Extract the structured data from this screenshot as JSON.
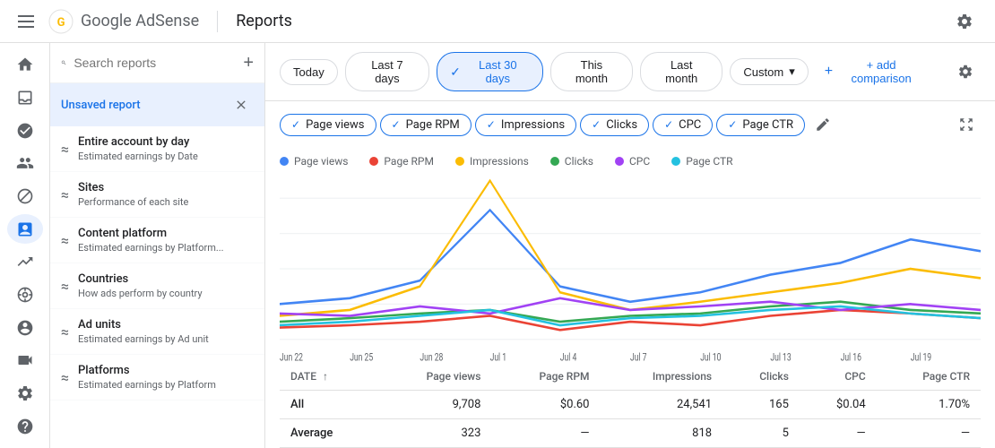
{
  "app": {
    "name": "Google AdSense",
    "page": "Reports"
  },
  "filters": {
    "buttons": [
      {
        "id": "today",
        "label": "Today",
        "active": false
      },
      {
        "id": "last7",
        "label": "Last 7 days",
        "active": false
      },
      {
        "id": "last30",
        "label": "Last 30 days",
        "active": true
      },
      {
        "id": "thismonth",
        "label": "This month",
        "active": false
      },
      {
        "id": "lastmonth",
        "label": "Last month",
        "active": false
      },
      {
        "id": "custom",
        "label": "Custom",
        "active": false
      }
    ],
    "add_comparison": "+ add comparison"
  },
  "metrics": [
    {
      "id": "pageviews",
      "label": "Page views",
      "color": "#4285f4",
      "active": true
    },
    {
      "id": "pagerpm",
      "label": "Page RPM",
      "color": "#ea4335",
      "active": true
    },
    {
      "id": "impressions",
      "label": "Impressions",
      "color": "#fbbc04",
      "active": true
    },
    {
      "id": "clicks",
      "label": "Clicks",
      "color": "#34a853",
      "active": true
    },
    {
      "id": "cpc",
      "label": "CPC",
      "color": "#a142f4",
      "active": true
    },
    {
      "id": "pagectr",
      "label": "Page CTR",
      "color": "#24c1e0",
      "active": true
    }
  ],
  "chart": {
    "x_labels": [
      "Jun 22",
      "Jun 25",
      "Jun 28",
      "Jul 1",
      "Jul 4",
      "Jul 7",
      "Jul 10",
      "Jul 13",
      "Jul 16",
      "Jul 19"
    ]
  },
  "sidebar": {
    "search_placeholder": "Search reports",
    "add_label": "+",
    "unsaved_label": "Unsaved report",
    "reports": [
      {
        "name": "Entire account by day",
        "sub": "Estimated earnings by Date"
      },
      {
        "name": "Sites",
        "sub": "Performance of each site"
      },
      {
        "name": "Content platform",
        "sub": "Estimated earnings by Platform..."
      },
      {
        "name": "Countries",
        "sub": "How ads perform by country"
      },
      {
        "name": "Ad units",
        "sub": "Estimated earnings by Ad unit"
      },
      {
        "name": "Platforms",
        "sub": "Estimated earnings by Platform"
      }
    ]
  },
  "table": {
    "columns": [
      "DATE",
      "Page views",
      "Page RPM",
      "Impressions",
      "Clicks",
      "CPC",
      "Page CTR"
    ],
    "rows": [
      {
        "label": "All",
        "pageviews": "9,708",
        "pagerpm": "$0.60",
        "impressions": "24,541",
        "clicks": "165",
        "cpc": "$0.04",
        "pagectr": "1.70%"
      },
      {
        "label": "Average",
        "pageviews": "323",
        "pagerpm": "—",
        "impressions": "818",
        "clicks": "5",
        "cpc": "—",
        "pagectr": "—"
      }
    ]
  }
}
